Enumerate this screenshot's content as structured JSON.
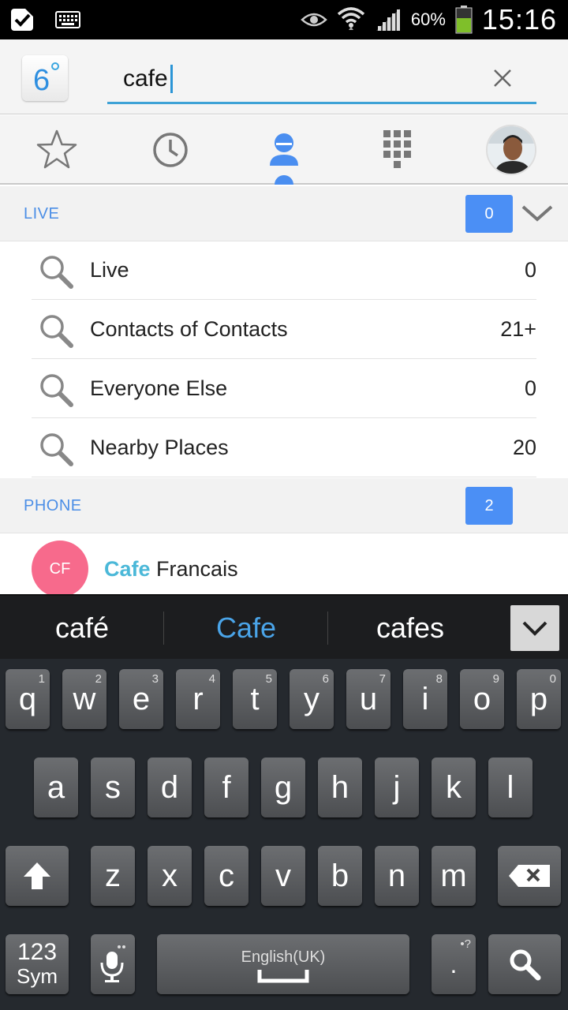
{
  "status_bar": {
    "battery_percent": "60%",
    "time": "15:16",
    "icons": [
      "check-badge-icon",
      "keyboard-icon",
      "eye-icon",
      "wifi-icon",
      "signal-icon",
      "battery-icon"
    ]
  },
  "header": {
    "logo_text": "6°",
    "search_value": "cafe",
    "clear_icon": "close-icon"
  },
  "tabs": [
    {
      "name": "favorites",
      "icon": "star-icon"
    },
    {
      "name": "recent",
      "icon": "clock-icon"
    },
    {
      "name": "contacts",
      "icon": "person-icon",
      "selected": true
    },
    {
      "name": "dialpad",
      "icon": "dialpad-icon"
    },
    {
      "name": "profile",
      "icon": "avatar"
    }
  ],
  "live_section": {
    "title": "LIVE",
    "count": "0",
    "rows": [
      {
        "label": "Live",
        "count": "0"
      },
      {
        "label": "Contacts of Contacts",
        "count": "21+"
      },
      {
        "label": "Everyone Else",
        "count": "0"
      },
      {
        "label": "Nearby Places",
        "count": "20"
      }
    ]
  },
  "phone_section": {
    "title": "PHONE",
    "count": "2",
    "contacts": [
      {
        "initials": "CF",
        "match": "Cafe",
        "rest": " Francais"
      }
    ]
  },
  "suggestions": [
    "café",
    "Cafe",
    "cafes"
  ],
  "keyboard": {
    "row1": [
      {
        "k": "q",
        "h": "1"
      },
      {
        "k": "w",
        "h": "2"
      },
      {
        "k": "e",
        "h": "3"
      },
      {
        "k": "r",
        "h": "4"
      },
      {
        "k": "t",
        "h": "5"
      },
      {
        "k": "y",
        "h": "6"
      },
      {
        "k": "u",
        "h": "7"
      },
      {
        "k": "i",
        "h": "8"
      },
      {
        "k": "o",
        "h": "9"
      },
      {
        "k": "p",
        "h": "0"
      }
    ],
    "row2": [
      "a",
      "s",
      "d",
      "f",
      "g",
      "h",
      "j",
      "k",
      "l"
    ],
    "row3": [
      "z",
      "x",
      "c",
      "v",
      "b",
      "n",
      "m"
    ],
    "sym_top": "123",
    "sym_bottom": "Sym",
    "space_label": "English(UK)",
    "period": ".",
    "period_hint": "•?"
  },
  "colors": {
    "accent": "#4b8ff5",
    "section_title": "#4b8ee6",
    "highlight": "#4bb8d8",
    "initials_bg": "#f76a8c"
  }
}
